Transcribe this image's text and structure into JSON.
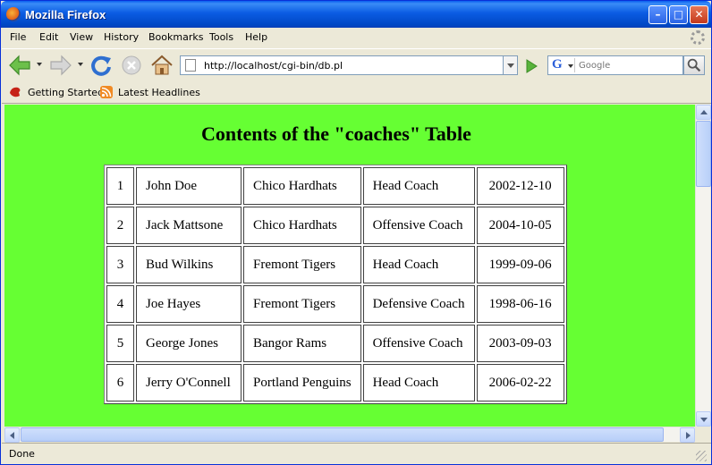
{
  "window": {
    "title": "Mozilla Firefox",
    "minimize_glyph": "–",
    "maximize_glyph": "□",
    "close_glyph": "✕"
  },
  "menu": {
    "items": [
      {
        "label": "File"
      },
      {
        "label": "Edit"
      },
      {
        "label": "View"
      },
      {
        "label": "History"
      },
      {
        "label": "Bookmarks"
      },
      {
        "label": "Tools"
      },
      {
        "label": "Help"
      }
    ]
  },
  "nav": {
    "url": "http://localhost/cgi-bin/db.pl",
    "search_placeholder": "Google",
    "search_engine_letter": "G"
  },
  "bookmarks": {
    "items": [
      {
        "label": "Getting Started",
        "icon": "firefox-bookmark-icon"
      },
      {
        "label": "Latest Headlines",
        "icon": "rss-feed-icon"
      }
    ]
  },
  "page": {
    "heading": "Contents of the \"coaches\" Table",
    "background_color": "#66ff33",
    "rows": [
      {
        "id": "1",
        "name": "John Doe",
        "team": "Chico Hardhats",
        "role": "Head Coach",
        "date": "2002-12-10"
      },
      {
        "id": "2",
        "name": "Jack Mattsone",
        "team": "Chico Hardhats",
        "role": "Offensive Coach",
        "date": "2004-10-05"
      },
      {
        "id": "3",
        "name": "Bud Wilkins",
        "team": "Fremont Tigers",
        "role": "Head Coach",
        "date": "1999-09-06"
      },
      {
        "id": "4",
        "name": "Joe Hayes",
        "team": "Fremont Tigers",
        "role": "Defensive Coach",
        "date": "1998-06-16"
      },
      {
        "id": "5",
        "name": "George Jones",
        "team": "Bangor Rams",
        "role": "Offensive Coach",
        "date": "2003-09-03"
      },
      {
        "id": "6",
        "name": "Jerry O'Connell",
        "team": "Portland Penguins",
        "role": "Head Coach",
        "date": "2006-02-22"
      }
    ]
  },
  "status": {
    "text": "Done"
  }
}
